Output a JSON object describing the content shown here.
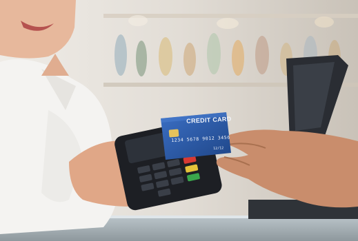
{
  "image": {
    "subject": "customer tapping a credit card on a payment terminal held by a cashier",
    "card": {
      "title": "CREDIT CARD",
      "number": "1234 5678 9012 3456",
      "expiry": "12/12",
      "color": "#2b59a8"
    },
    "colors": {
      "background": "#e8e4de",
      "shirt": "#f4f3f1",
      "skin": "#d9a386",
      "terminal": "#1d1f24"
    }
  }
}
